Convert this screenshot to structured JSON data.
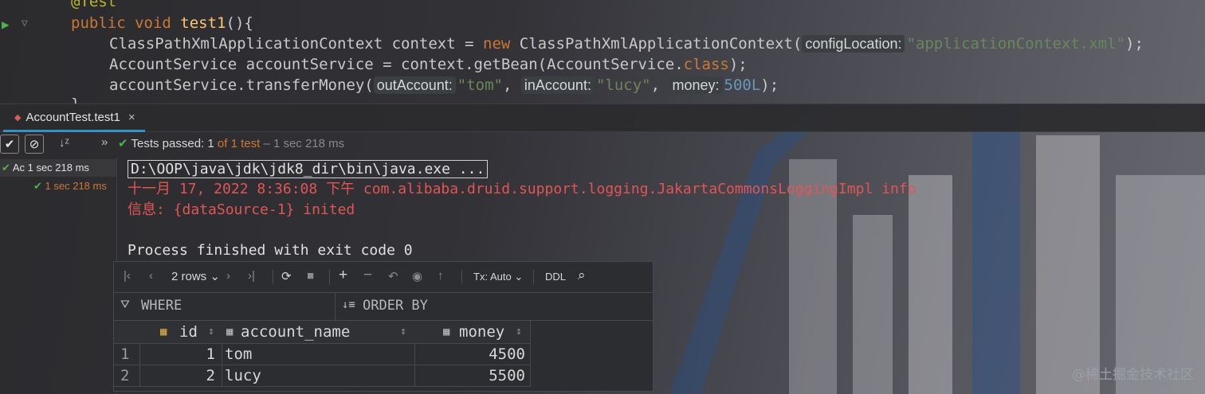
{
  "editor": {
    "annotation": "@Test",
    "line1": {
      "kw": "public void",
      "fn": "test1",
      "rest": "(){"
    },
    "line2": {
      "type": "ClassPathXmlApplicationContext context = ",
      "kw": "new",
      "ctor": " ClassPathXmlApplicationContext(",
      "hint": "configLocation:",
      "arg": "\"applicationContext.xml\"",
      "end": ");"
    },
    "line3": {
      "text": "AccountService accountService = context.getBean(AccountService.",
      "kw": "class",
      "end": ");"
    },
    "line4": {
      "call": "accountService.transferMoney(",
      "hint1": "outAccount:",
      "arg1": "\"tom\"",
      "sep1": ", ",
      "hint2": "inAccount:",
      "arg2": "\"lucy\"",
      "sep2": ", ",
      "hint3": "money:",
      "arg3": "500L",
      "end": ");"
    },
    "line5": "}"
  },
  "run_tab": {
    "label": "AccountTest.test1",
    "close": "×"
  },
  "run_toolbar": {
    "status_prefix": "Tests passed:",
    "passed": "1",
    "of_text": "of 1 test",
    "duration": "– 1 sec 218 ms"
  },
  "test_tree": [
    {
      "label": "Ac",
      "time": "1 sec 218 ms"
    },
    {
      "label": "",
      "time": "1 sec 218 ms"
    }
  ],
  "console": {
    "cmd": "D:\\OOP\\java\\jdk\\jdk8_dir\\bin\\java.exe ...",
    "log1": "十一月 17, 2022 8:36:08 下午 com.alibaba.druid.support.logging.JakartaCommonsLoggingImpl info",
    "log2": "信息: {dataSource-1} inited",
    "exit": "Process finished with exit code 0"
  },
  "grid": {
    "rows_label": "2 rows",
    "tx_label": "Tx: Auto",
    "ddl_label": "DDL",
    "where_label": "WHERE",
    "order_label": "ORDER BY",
    "columns": [
      "id",
      "account_name",
      "money"
    ],
    "rows": [
      {
        "num": "1",
        "id": "1",
        "account_name": "tom",
        "money": "4500"
      },
      {
        "num": "2",
        "id": "2",
        "account_name": "lucy",
        "money": "5500"
      }
    ]
  },
  "watermark": "@稀土掘金技术社区",
  "colors": {
    "accent": "#3592c4",
    "pass": "#4fb24a",
    "error": "#e25555"
  }
}
